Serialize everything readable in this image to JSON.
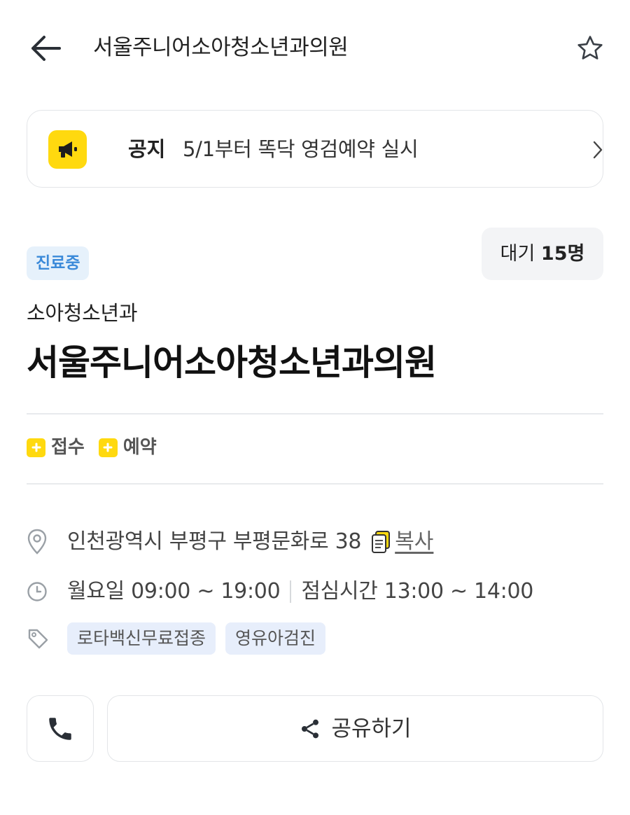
{
  "header": {
    "title": "서울주니어소아청소년과의원",
    "back_icon": "arrow-left-icon",
    "favorite_icon": "star-outline-icon"
  },
  "notice": {
    "icon": "megaphone-icon",
    "label": "공지",
    "text": "5/1부터 똑닥 영검예약 실시",
    "chevron_icon": "chevron-right-icon"
  },
  "status": {
    "badge": "진료중",
    "wait_label": "대기",
    "wait_count": "15명"
  },
  "clinic": {
    "category": "소아청소년과",
    "name": "서울주니어소아청소년과의원"
  },
  "services": [
    {
      "label": "접수",
      "icon": "plus-box-icon"
    },
    {
      "label": "예약",
      "icon": "plus-box-icon"
    }
  ],
  "info": {
    "address": "인천광역시 부평구 부평문화로 38",
    "copy_label": "복사",
    "hours": "월요일 09:00 ~ 19:00",
    "lunch": "점심시간 13:00 ~ 14:00",
    "keywords": [
      "로타백신무료접종",
      "영유아검진"
    ]
  },
  "actions": {
    "call_icon": "phone-icon",
    "share_label": "공유하기",
    "share_icon": "share-icon"
  },
  "colors": {
    "brand_yellow": "#ffd90f",
    "status_blue": "#3b8ad9",
    "status_bg": "#e6f1fb",
    "chip_bg": "#e7eefb"
  }
}
